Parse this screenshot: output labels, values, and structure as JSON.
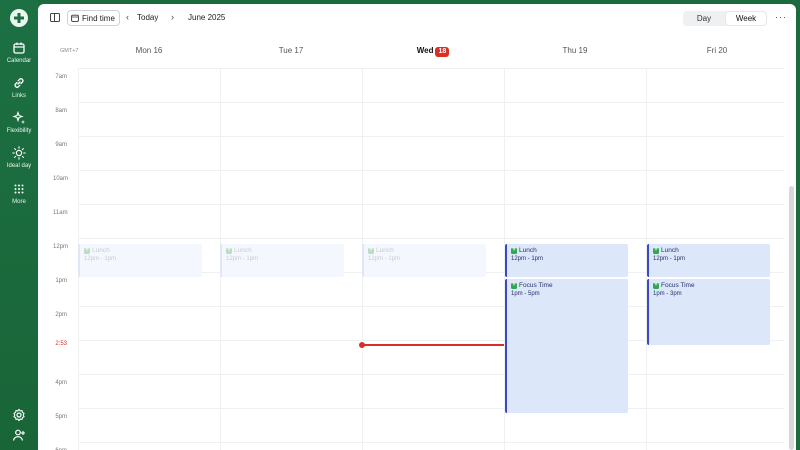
{
  "sidebar": {
    "items": [
      {
        "label": "Calendar",
        "icon": "calendar-icon"
      },
      {
        "label": "Links",
        "icon": "link-icon"
      },
      {
        "label": "Flexibility",
        "icon": "sparkle-icon"
      },
      {
        "label": "Ideal day",
        "icon": "sun-icon"
      },
      {
        "label": "More",
        "icon": "grid-dots-icon"
      }
    ],
    "bottom_icons": [
      "gear-icon",
      "user-plus-icon"
    ]
  },
  "toolbar": {
    "find_time_label": "Find time",
    "today_label": "Today",
    "month_label": "June 2025",
    "view_day_label": "Day",
    "view_week_label": "Week",
    "selected_view": "Week",
    "more_label": "···"
  },
  "calendar": {
    "timezone": "GMT+7",
    "days": [
      {
        "label": "Mon 16",
        "is_today": false
      },
      {
        "label": "Tue 17",
        "is_today": false
      },
      {
        "label": "Wed",
        "number": "18",
        "is_today": true
      },
      {
        "label": "Thu 19",
        "is_today": false
      },
      {
        "label": "Fri 20",
        "is_today": false
      }
    ],
    "hours": [
      "7am",
      "8am",
      "9am",
      "10am",
      "11am",
      "12pm",
      "1pm",
      "2pm",
      "",
      "4pm",
      "5pm",
      "6pm"
    ],
    "now_label": "2:53",
    "events": [
      {
        "title": "Lunch",
        "time": "12pm - 1pm",
        "state": "past"
      },
      {
        "title": "Lunch",
        "time": "12pm - 1pm",
        "state": "past"
      },
      {
        "title": "Lunch",
        "time": "12pm - 1pm",
        "state": "past"
      },
      {
        "title": "Lunch",
        "time": "12pm - 1pm",
        "state": "future"
      },
      {
        "title": "Focus Time",
        "time": "1pm - 5pm",
        "state": "future"
      },
      {
        "title": "Lunch",
        "time": "12pm - 1pm",
        "state": "future"
      },
      {
        "title": "Focus Time",
        "time": "1pm - 3pm",
        "state": "future"
      }
    ]
  },
  "colors": {
    "sidebar_bg": "#1b6b3e",
    "today_accent": "#d93025",
    "event_fill": "#dce7fa",
    "event_border": "#3b47c4",
    "event_icon": "#2fa84f"
  }
}
